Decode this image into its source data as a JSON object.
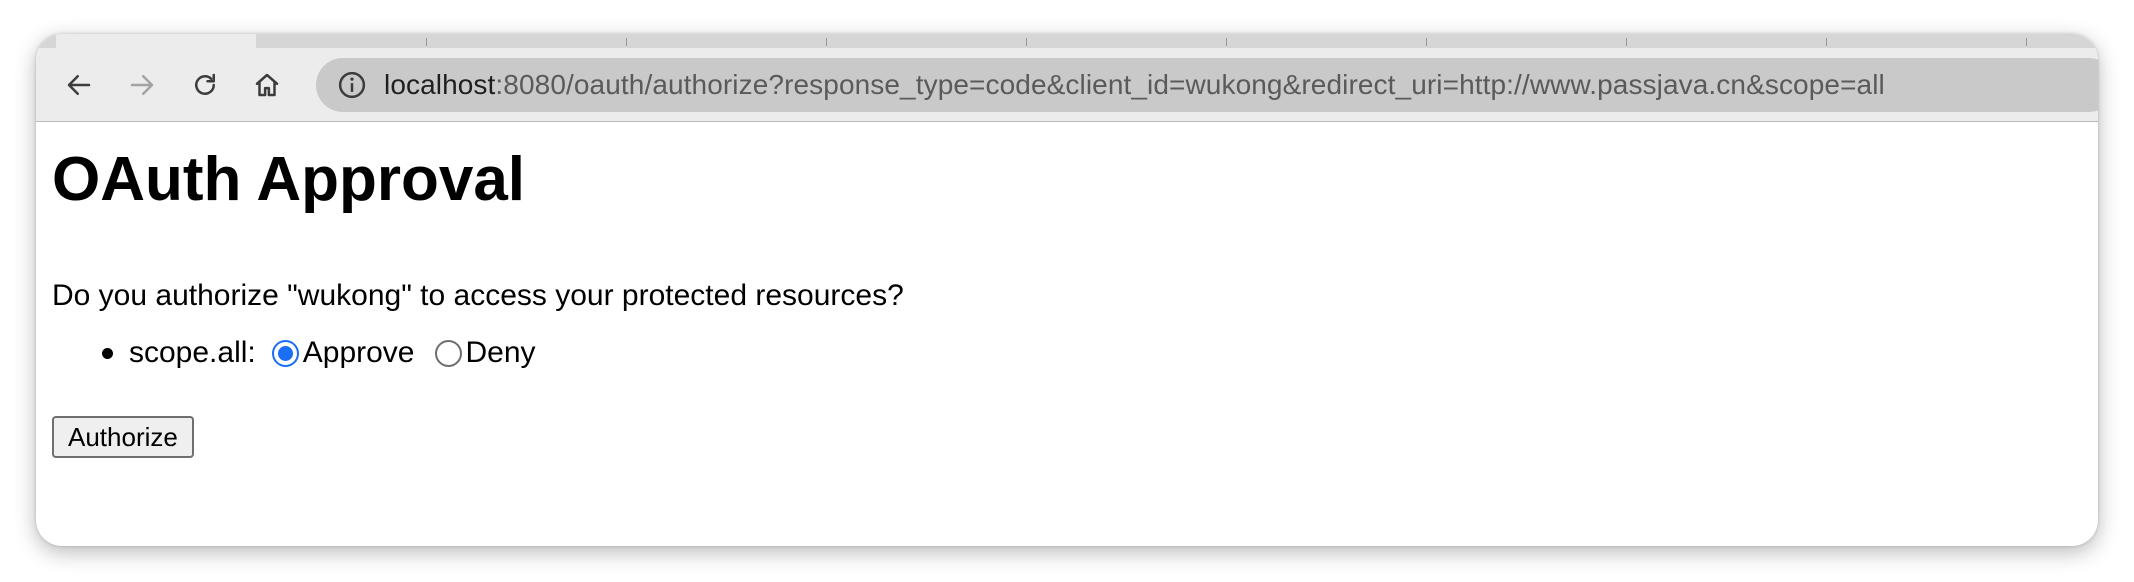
{
  "browser": {
    "url_host": "localhost",
    "url_rest": ":8080/oauth/authorize?response_type=code&client_id=wukong&redirect_uri=http://www.passjava.cn&scope=all",
    "icons": [
      "back-icon",
      "forward-icon",
      "reload-icon",
      "home-icon",
      "site-info-icon"
    ]
  },
  "page": {
    "title": "OAuth Approval",
    "question": "Do you authorize \"wukong\" to access your protected resources?",
    "scopes": [
      {
        "label": "scope.all:",
        "options": [
          {
            "label": "Approve",
            "selected": true
          },
          {
            "label": "Deny",
            "selected": false
          }
        ]
      }
    ],
    "submit_label": "Authorize"
  },
  "colors": {
    "radio_checked": "#1a6ef5"
  }
}
